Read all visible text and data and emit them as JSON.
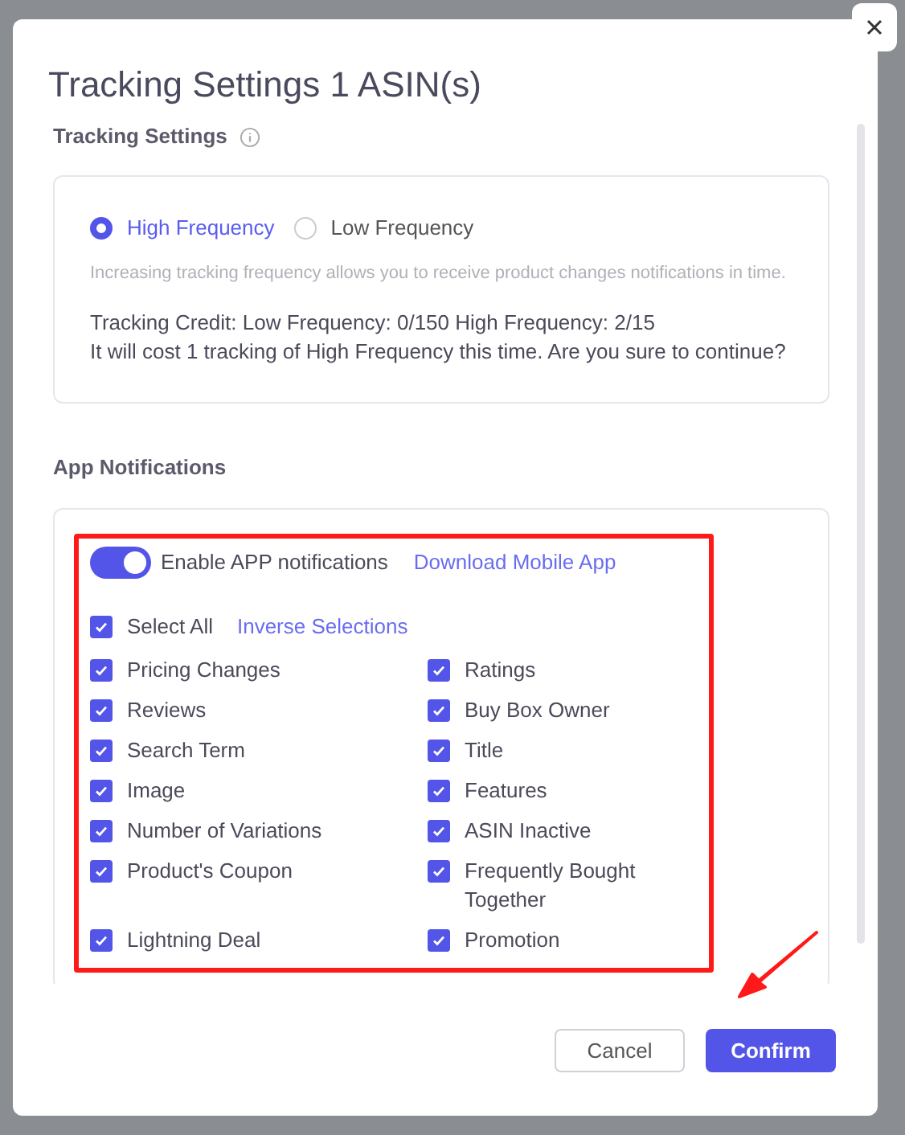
{
  "dialog": {
    "title": "Tracking Settings 1 ASIN(s)"
  },
  "tracking_settings": {
    "heading": "Tracking Settings",
    "frequency_options": [
      {
        "label": "High Frequency",
        "selected": true
      },
      {
        "label": "Low Frequency",
        "selected": false
      }
    ],
    "hint": "Increasing tracking frequency allows you to receive product changes notifications in time.",
    "credit": "Tracking Credit: Low Frequency: 0/150 High Frequency: 2/15",
    "confirm_note": "It will cost 1 tracking of High Frequency this time. Are you sure to continue?"
  },
  "app_notifications": {
    "heading": "App Notifications",
    "enable_toggle": {
      "label": "Enable APP notifications",
      "on": true
    },
    "download_link": "Download Mobile App",
    "select_all": {
      "label": "Select All",
      "checked": true
    },
    "inverse_link": "Inverse Selections",
    "options": [
      {
        "label": "Pricing Changes",
        "checked": true
      },
      {
        "label": "Ratings",
        "checked": true
      },
      {
        "label": "Reviews",
        "checked": true
      },
      {
        "label": "Buy Box Owner",
        "checked": true
      },
      {
        "label": "Search Term",
        "checked": true
      },
      {
        "label": "Title",
        "checked": true
      },
      {
        "label": "Image",
        "checked": true
      },
      {
        "label": "Features",
        "checked": true
      },
      {
        "label": "Number of Variations",
        "checked": true
      },
      {
        "label": "ASIN Inactive",
        "checked": true
      },
      {
        "label": "Product's Coupon",
        "checked": true
      },
      {
        "label": "Frequently Bought Together",
        "checked": true
      },
      {
        "label": "Lightning Deal",
        "checked": true
      },
      {
        "label": "Promotion",
        "checked": true
      }
    ]
  },
  "buttons": {
    "cancel": "Cancel",
    "confirm": "Confirm"
  }
}
